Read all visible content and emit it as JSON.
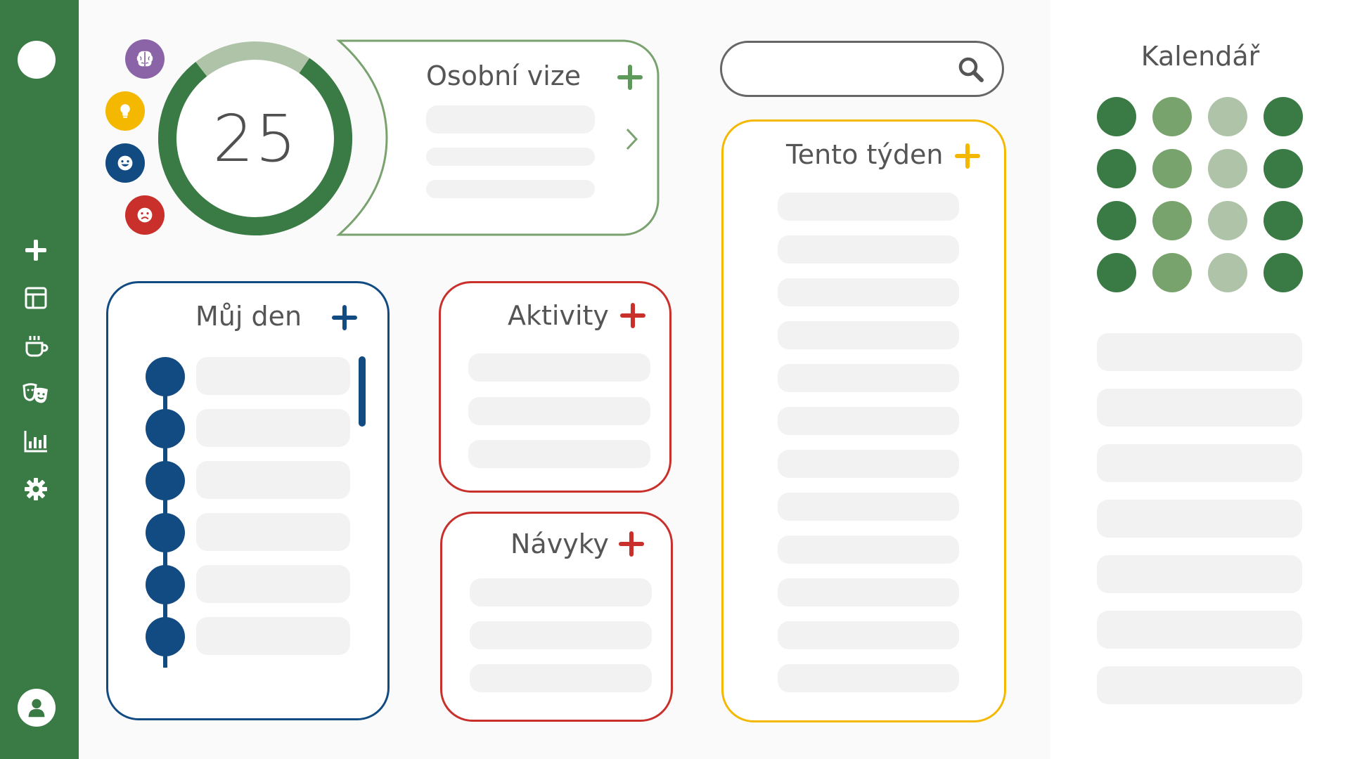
{
  "score": {
    "value": "25",
    "progress": 0.8
  },
  "mood_icons": [
    {
      "name": "brain",
      "color": "#8a64a6"
    },
    {
      "name": "lightbulb",
      "color": "#f5b800"
    },
    {
      "name": "smile",
      "color": "#124a82"
    },
    {
      "name": "sad",
      "color": "#c9302c"
    }
  ],
  "vision": {
    "title": "Osobní vize",
    "accent": "#5d9a5a"
  },
  "search": {
    "placeholder": ""
  },
  "my_day": {
    "title": "Můj den",
    "accent": "#124a82"
  },
  "activities": {
    "title": "Aktivity",
    "accent": "#c9302c"
  },
  "habits": {
    "title": "Návyky",
    "accent": "#c9302c"
  },
  "this_week": {
    "title": "Tento týden",
    "accent": "#f5b800"
  },
  "calendar": {
    "title": "Kalendář",
    "dot_colors": [
      "#3a7a45",
      "#79a36d",
      "#aec3a8",
      "#3a7a45"
    ]
  },
  "colors": {
    "sidebar": "#3a7a45",
    "ring_light": "#aec3a8",
    "ring_dark": "#3a7a45"
  }
}
